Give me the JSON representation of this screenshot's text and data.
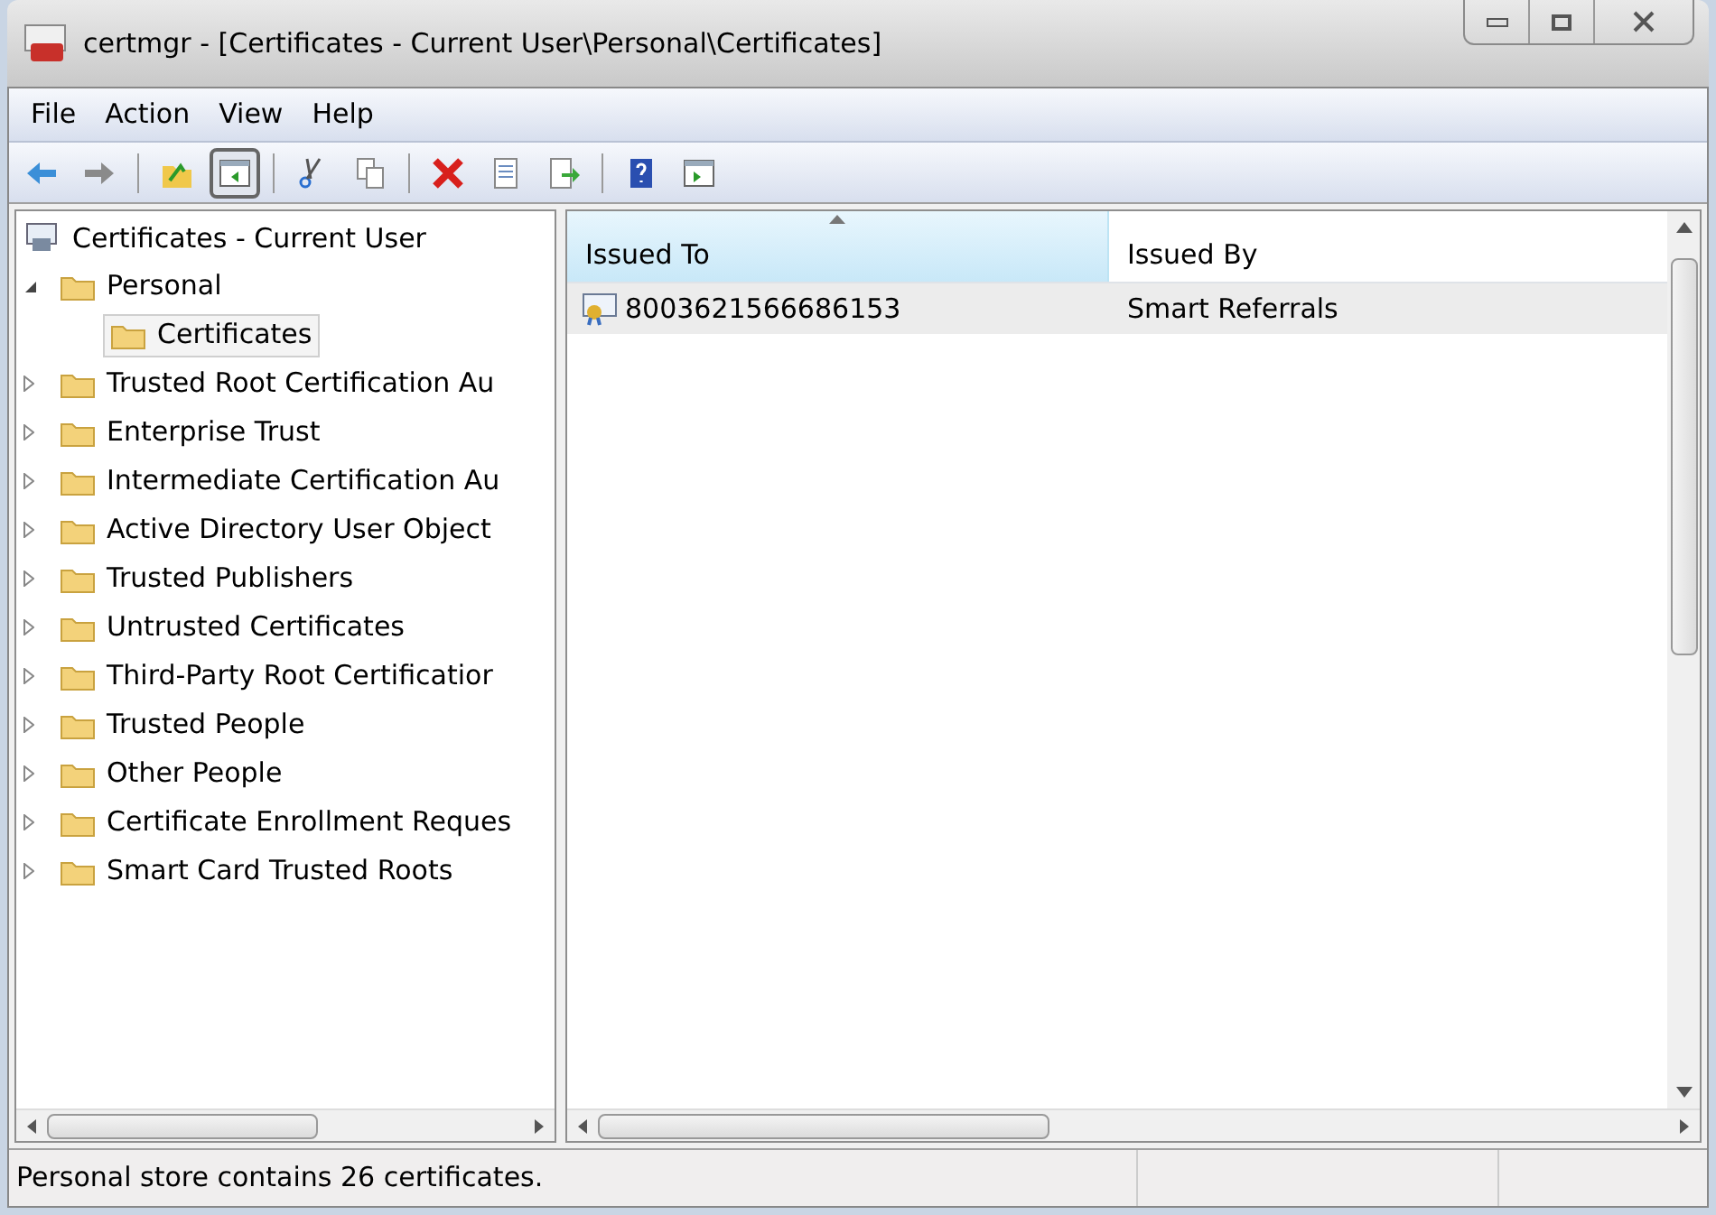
{
  "window": {
    "title": "certmgr - [Certificates - Current User\\Personal\\Certificates]"
  },
  "menu": [
    "File",
    "Action",
    "View",
    "Help"
  ],
  "toolbar": [
    {
      "kind": "back",
      "pressed": false
    },
    {
      "kind": "forward",
      "pressed": false
    },
    {
      "kind": "sep"
    },
    {
      "kind": "up",
      "pressed": false
    },
    {
      "kind": "tree",
      "pressed": true
    },
    {
      "kind": "sep"
    },
    {
      "kind": "cut",
      "pressed": false
    },
    {
      "kind": "copy",
      "pressed": false
    },
    {
      "kind": "sep"
    },
    {
      "kind": "delete",
      "pressed": false
    },
    {
      "kind": "properties",
      "pressed": false
    },
    {
      "kind": "export",
      "pressed": false
    },
    {
      "kind": "sep"
    },
    {
      "kind": "help",
      "pressed": false
    },
    {
      "kind": "pane",
      "pressed": false
    }
  ],
  "tree": {
    "label": "Certificates - Current User",
    "children": [
      {
        "label": "Personal",
        "expanded": true,
        "selected": false,
        "children": [
          {
            "label": "Certificates",
            "selected": true
          }
        ]
      },
      {
        "label": "Trusted Root Certification Au",
        "expanded": false,
        "selected": false
      },
      {
        "label": "Enterprise Trust",
        "expanded": false,
        "selected": false
      },
      {
        "label": "Intermediate Certification Au",
        "expanded": false,
        "selected": false
      },
      {
        "label": "Active Directory User Object",
        "expanded": false,
        "selected": false
      },
      {
        "label": "Trusted Publishers",
        "expanded": false,
        "selected": false
      },
      {
        "label": "Untrusted Certificates",
        "expanded": false,
        "selected": false
      },
      {
        "label": "Third-Party Root Certificatior",
        "expanded": false,
        "selected": false
      },
      {
        "label": "Trusted People",
        "expanded": false,
        "selected": false
      },
      {
        "label": "Other People",
        "expanded": false,
        "selected": false
      },
      {
        "label": "Certificate Enrollment Reques",
        "expanded": false,
        "selected": false
      },
      {
        "label": "Smart Card Trusted Roots",
        "expanded": false,
        "selected": false
      }
    ]
  },
  "table": {
    "columns": [
      {
        "label": "Issued To",
        "sorted": true
      },
      {
        "label": "Issued By",
        "sorted": false
      }
    ],
    "rows": [
      {
        "cells": [
          "8003621566686153",
          "Smart Referrals"
        ],
        "selected": true
      }
    ]
  },
  "status_bar": "Personal store contains 26 certificates."
}
